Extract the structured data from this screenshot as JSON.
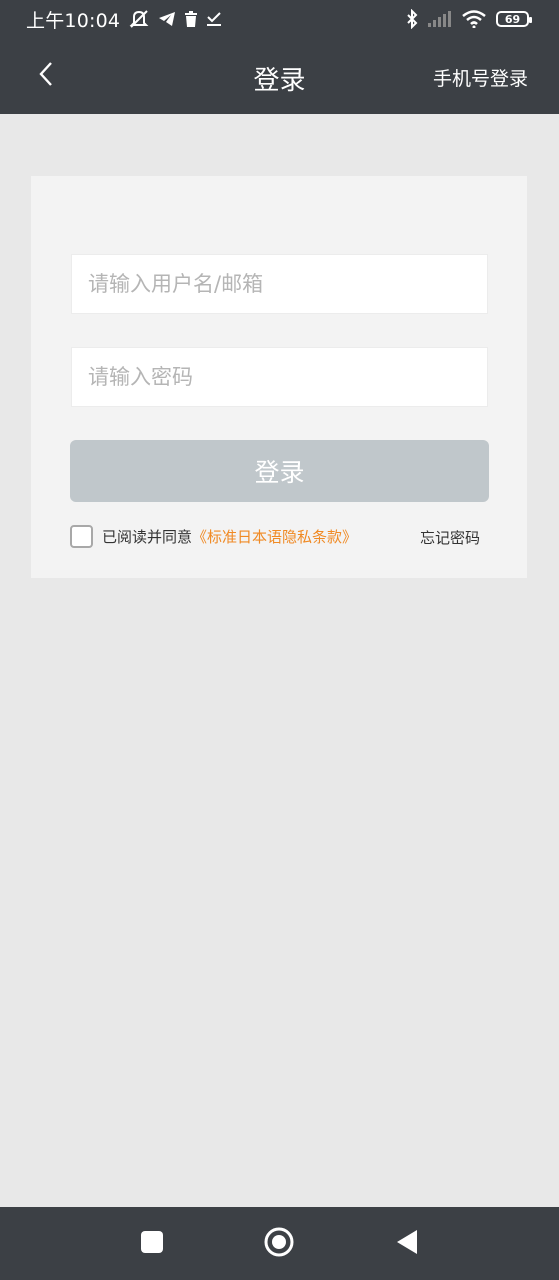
{
  "status_bar": {
    "time": "上午10:04",
    "battery": "69",
    "icons": [
      "mute-bell-icon",
      "telegram-icon",
      "trash-icon",
      "download-check-icon",
      "bluetooth-icon",
      "signal-icon",
      "wifi-icon",
      "battery-icon"
    ]
  },
  "app_bar": {
    "title": "登录",
    "right_action": "手机号登录",
    "back_icon": "chevron-left-icon"
  },
  "form": {
    "username_placeholder": "请输入用户名/邮箱",
    "password_placeholder": "请输入密码",
    "login_button": "登录",
    "agree_text": "已阅读并同意",
    "policy_link": "《标准日本语隐私条款》",
    "forgot_password": "忘记密码"
  },
  "colors": {
    "app_bar": "#3c4045",
    "background": "#e8e8e8",
    "card": "#f3f3f3",
    "button_disabled": "#c0c7cb",
    "link": "#f08a24"
  },
  "nav_bar": {
    "icons": [
      "recent-apps-square-icon",
      "home-circle-icon",
      "back-triangle-icon"
    ]
  }
}
